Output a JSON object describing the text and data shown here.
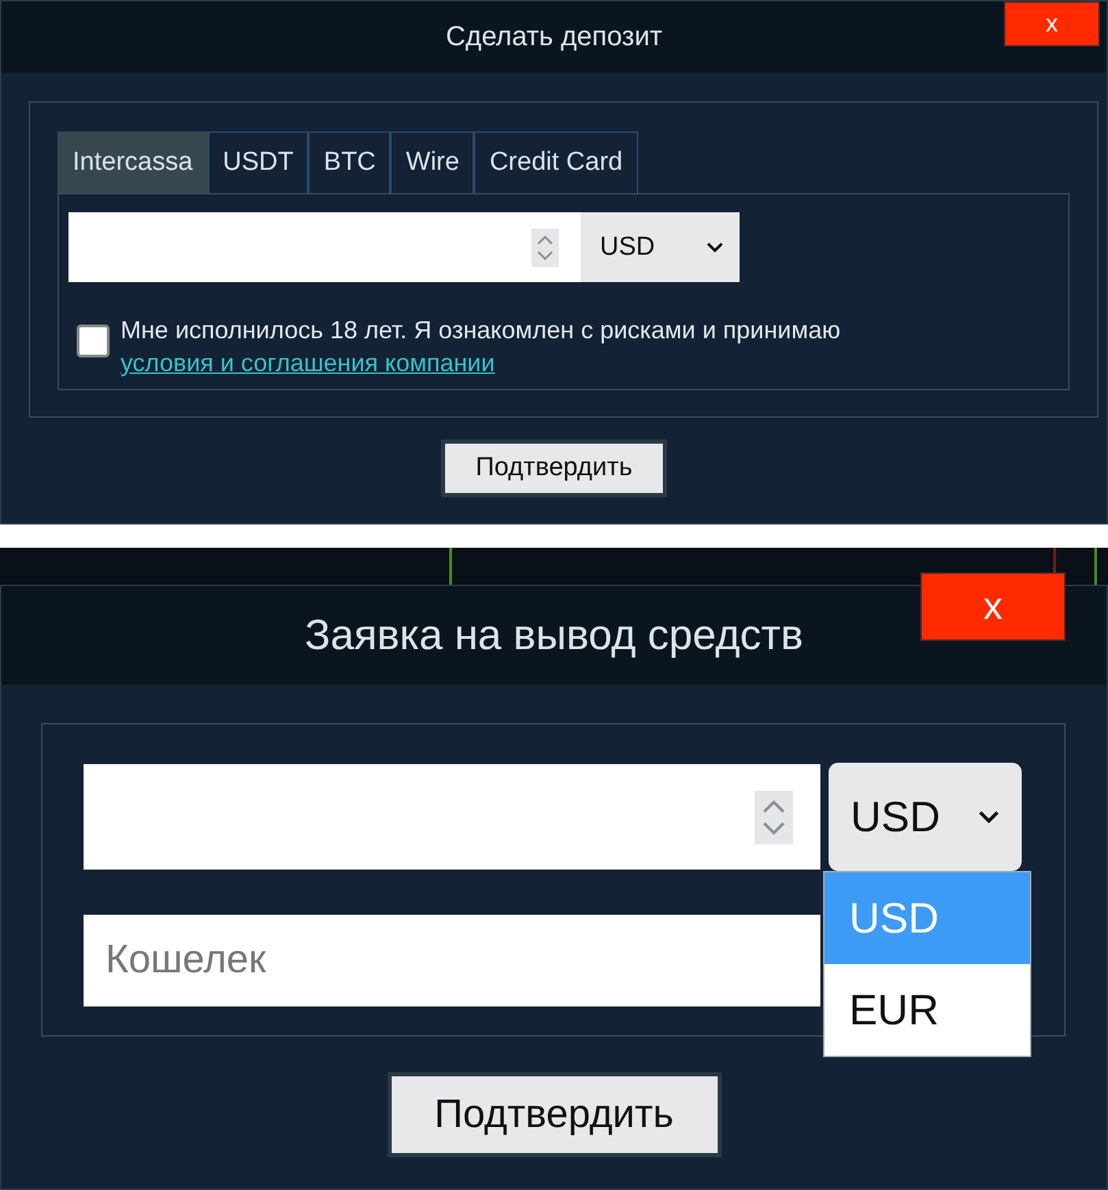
{
  "deposit": {
    "title": "Сделать депозит",
    "close": "x",
    "tabs": [
      {
        "label": "Intercassa",
        "selected": true
      },
      {
        "label": "USDT",
        "selected": false
      },
      {
        "label": "BTC",
        "selected": false
      },
      {
        "label": "Wire",
        "selected": false
      },
      {
        "label": "Credit Card",
        "selected": false
      }
    ],
    "currency": "USD",
    "agreement": {
      "checked": false,
      "text": "Мне исполнилось 18 лет. Я ознакомлен с рисками и принимаю",
      "link": "условия и соглашения компании"
    },
    "confirm": "Подтвердить"
  },
  "withdraw": {
    "title": "Заявка на вывод средств",
    "close": "x",
    "currency": "USD",
    "wallet": {
      "placeholder": "Кошелек"
    },
    "options": [
      {
        "label": "USD",
        "selected": true
      },
      {
        "label": "EUR",
        "selected": false
      }
    ],
    "confirm": "Подтвердить"
  }
}
